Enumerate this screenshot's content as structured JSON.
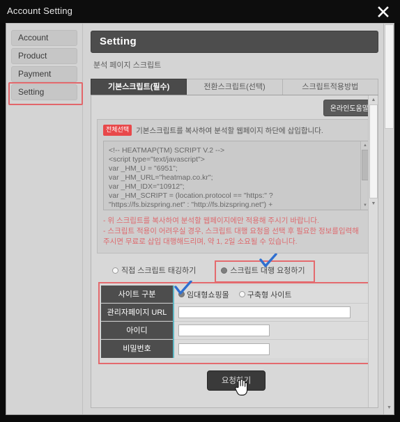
{
  "window": {
    "title": "Account Setting",
    "close_icon": "close-icon"
  },
  "sidebar": {
    "items": [
      {
        "label": "Account",
        "active": false
      },
      {
        "label": "Product",
        "active": false
      },
      {
        "label": "Payment",
        "active": false
      },
      {
        "label": "Setting",
        "active": true
      }
    ]
  },
  "content": {
    "page_title": "Setting",
    "subtitle": "분석 페이지 스크립트",
    "tabs": [
      {
        "label": "기본스크립트(필수)",
        "active": true
      },
      {
        "label": "전환스크립트(선택)",
        "active": false
      },
      {
        "label": "스크립트적용방법",
        "active": false
      }
    ],
    "help_button": "온라인도움말",
    "select_all_badge": "전체선택",
    "select_all_text": "기본스크립트를 복사하여 분석할 웹페이지 하단에 삽입합니다.",
    "code": "<!-- HEATMAP(TM) SCRIPT V.2 -->\n<script type=\"text/javascript\">\nvar _HM_U = \"6951\";\nvar _HM_URL=\"heatmap.co.kr\";\nvar _HM_IDX=\"10912\";\nvar _HM_SCRIPT = (location.protocol == \"https:\" ?\n\"https://fs.bizspring.net\" : \"http://fs.bizspring.net\") +",
    "notice_line1": "- 위 스크립트를 복사하여 분석할 웹페이지에만 적용해 주시기 바랍니다.",
    "notice_line2": "- 스크립트 적용이 어려우실 경우, 스크립트 대행 요청을 선택 후 필요한 정보를입력해",
    "notice_line3": "주시면 무료로 삽입 대행해드리며, 약 1, 2일 소요될 수 있습니다.",
    "mode_options": [
      {
        "label": "직접 스크립트 태깅하기",
        "selected": false
      },
      {
        "label": "스크립트 대행 요청하기",
        "selected": true
      }
    ],
    "form": {
      "rows": [
        {
          "label": "사이트 구분",
          "type": "radio"
        },
        {
          "label": "관리자페이지 URL",
          "type": "text",
          "value": "",
          "placeholder": ""
        },
        {
          "label": "아이디",
          "type": "text",
          "value": "",
          "placeholder": ""
        },
        {
          "label": "비밀번호",
          "type": "text",
          "value": "",
          "placeholder": ""
        }
      ],
      "site_type_options": [
        {
          "label": "임대형쇼핑몰",
          "selected": true
        },
        {
          "label": "구축형 사이트",
          "selected": false
        }
      ]
    },
    "submit_button": "요청하기"
  },
  "colors": {
    "accent_red": "#e46a6e",
    "badge_red": "#e8484a",
    "header_dark": "#4d4d4d",
    "notice_red": "#dd6a6e",
    "check_blue": "#2f6fd0",
    "teal": "#5fb8c4"
  }
}
